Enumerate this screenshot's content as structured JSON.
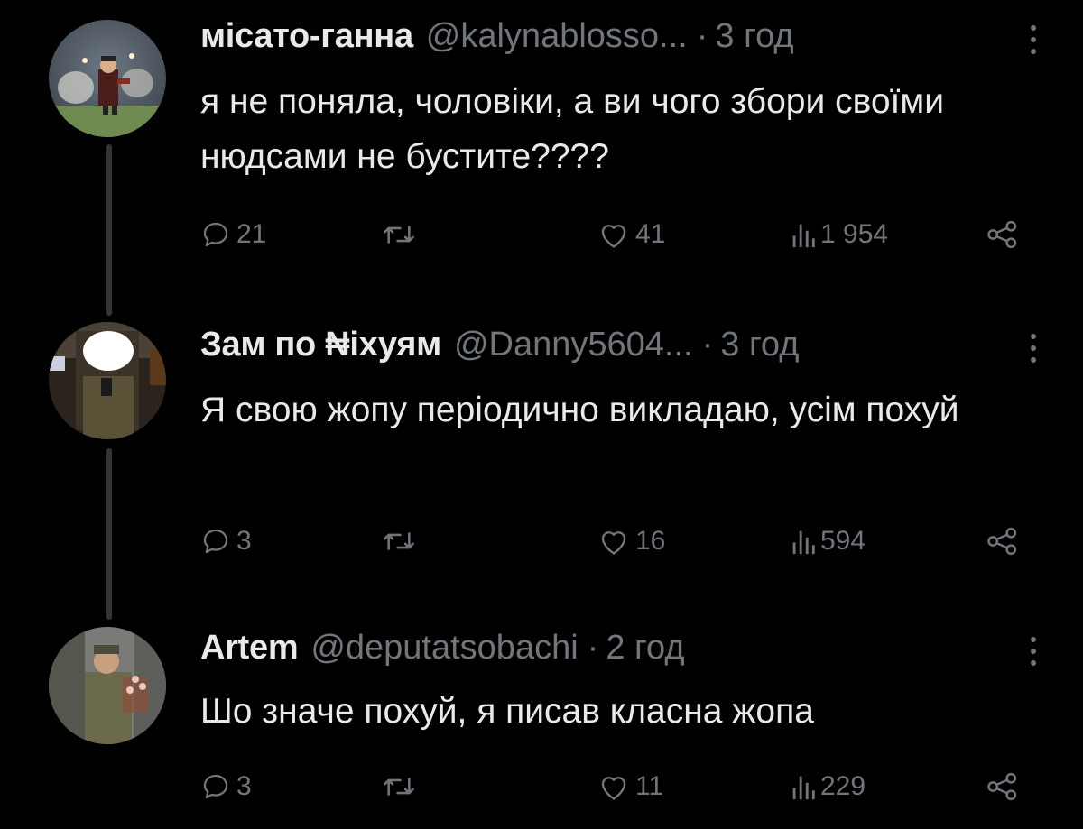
{
  "colors": {
    "background": "#000000",
    "text_primary": "#e7e9ea",
    "text_secondary": "#71767b",
    "thread_line": "#333639"
  },
  "icons": {
    "reply": "speech-bubble-icon",
    "repost": "repost-arrows-icon",
    "like": "heart-icon",
    "views": "bar-chart-icon",
    "share": "share-nodes-icon",
    "more": "vertical-dots-icon"
  },
  "tweets": [
    {
      "display_name": "місато-ганна",
      "handle": "@kalynablosso...",
      "separator": "·",
      "time": "3 год",
      "text": "я не поняла, чоловіки, а ви чого збори своїми нюдсами не бустите????",
      "replies": "21",
      "likes": "41",
      "views": "1 954"
    },
    {
      "display_name": "Зам по ₦іхуям",
      "handle": "@Danny5604...",
      "separator": "·",
      "time": "3 год",
      "text": "Я свою жопу періодично викладаю, усім похуй",
      "replies": "3",
      "likes": "16",
      "views": "594"
    },
    {
      "display_name": "Artem",
      "handle": "@deputatsobachi",
      "separator": "·",
      "time": "2 год",
      "text": "Шо значе похуй, я писав класна жопа",
      "replies": "3",
      "likes": "11",
      "views": "229"
    }
  ]
}
